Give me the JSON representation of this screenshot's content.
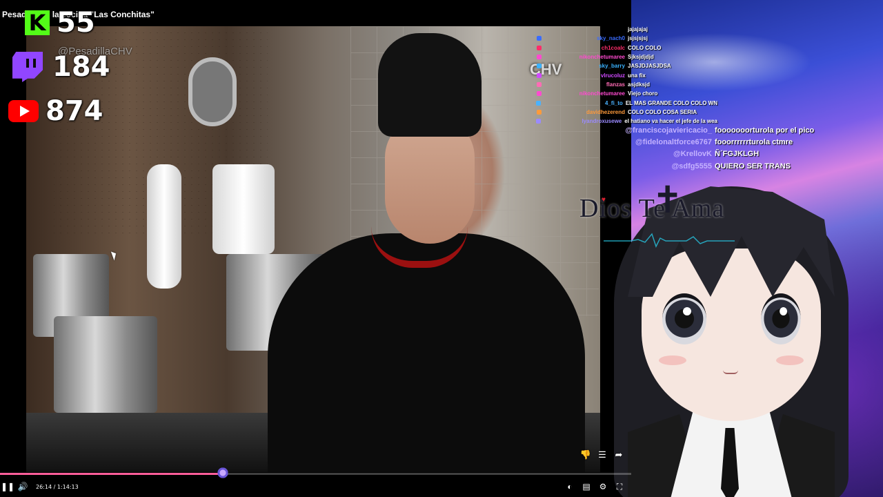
{
  "video": {
    "title": "Pesadilla en la cocina \"Las Conchitas\"",
    "watermark": "@PesadillaCHV",
    "channel_logo": "CHV"
  },
  "stats": {
    "kick": {
      "icon": "kick-icon",
      "letter": "K",
      "count": "55",
      "color": "#53fc18"
    },
    "twitch": {
      "icon": "twitch-icon",
      "count": "184",
      "color": "#9146ff"
    },
    "youtube": {
      "icon": "youtube-icon",
      "count": "874",
      "color": "#ff0000"
    }
  },
  "chat": [
    {
      "user": "",
      "message": "jajajajaj",
      "color": "#dddddd"
    },
    {
      "user": "sky_nach0",
      "message": "jsjsjsjsj",
      "color": "#3a6cff"
    },
    {
      "user": "ch1coalc",
      "message": "COLO COLO",
      "color": "#ff2d6a"
    },
    {
      "user": "nikonchetumaree",
      "message": "Sjksjdjdjd",
      "color": "#ff4ad0"
    },
    {
      "user": "sky_barry",
      "message": "JASJDJASJDSA",
      "color": "#3ab2ff"
    },
    {
      "user": "vlrucoluz",
      "message": "una fix",
      "color": "#d04aff"
    },
    {
      "user": "flanzas",
      "message": "asjdksjd",
      "color": "#ff6bb5"
    },
    {
      "user": "nikonchetumaree",
      "message": "Viejo choro",
      "color": "#ff4ad0"
    },
    {
      "user": "4_fi_to",
      "message": "EL MAS GRANDE COLO COLO WN",
      "color": "#4ab2ff"
    },
    {
      "user": "davidhezerend",
      "message": "COLO COLO COSA SERIA",
      "color": "#ff9a3a"
    },
    {
      "user": "lyandroxusewe",
      "message": "el hatiano va hacer el jefe de la wea",
      "color": "#9a8aff"
    }
  ],
  "chat2": [
    {
      "user": "@franciscojaviericacio_",
      "message": "fooooooorturola por el pico"
    },
    {
      "user": "@fidelonaltforce6767",
      "message": "fooorrrrrrturola ctmre"
    },
    {
      "user": "@KrellovK",
      "message": "Ñ´FGJKLGH"
    },
    {
      "user": "@sdfg5555",
      "message": "QUIERO SER TRANS"
    }
  ],
  "overlay_text": {
    "dios": "Dios Te Ama"
  },
  "player": {
    "time": "26:14 / 1:14:13",
    "progress_fraction": 0.353,
    "progress_color": "#ff5e9a"
  },
  "icons": {
    "pause": "pause-icon",
    "volume": "volume-icon",
    "settings": "settings-icon"
  }
}
